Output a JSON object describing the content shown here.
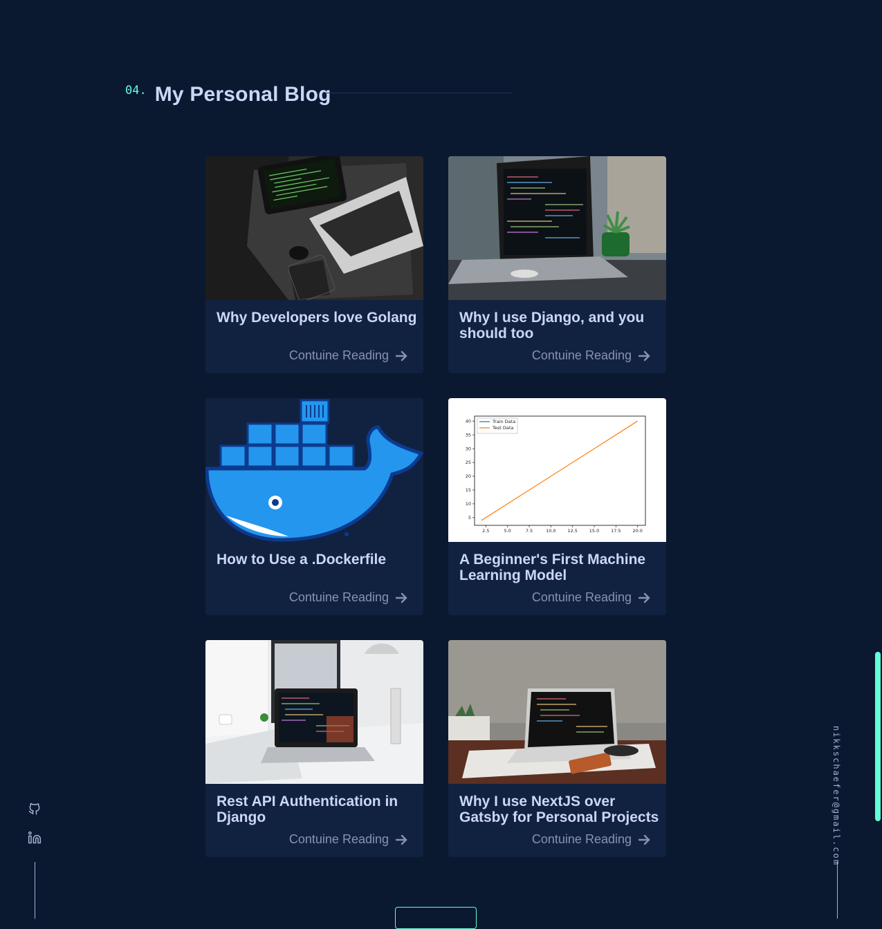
{
  "section": {
    "number": "04.",
    "title": "My Personal Blog"
  },
  "posts": [
    {
      "title": "Why Developers love Golang",
      "link_label": "Contuine Reading"
    },
    {
      "title": "Why I use Django, and you should too",
      "link_label": "Contuine Reading"
    },
    {
      "title": "How to Use a .Dockerfile",
      "link_label": "Contuine Reading"
    },
    {
      "title": "A Beginner's First Machine Learning Model",
      "link_label": "Contuine Reading",
      "chart_data": {
        "type": "line",
        "legend": [
          "Train Data",
          "Test Data"
        ],
        "x_ticks": [
          "2.5",
          "5.0",
          "7.5",
          "10.0",
          "12.5",
          "15.0",
          "17.5",
          "20.0"
        ],
        "y_ticks": [
          "5",
          "10",
          "15",
          "20",
          "25",
          "30",
          "35",
          "40"
        ],
        "series": [
          {
            "name": "Test Data",
            "x": [
              2,
              20
            ],
            "y": [
              4,
              40
            ]
          }
        ],
        "legend_position": "top-left"
      }
    },
    {
      "title": "Rest API Authentication in Django",
      "link_label": "Contuine Reading"
    },
    {
      "title": "Why I use NextJS over Gatsby for Personal Projects",
      "link_label": "Contuine Reading"
    }
  ],
  "email": "nikkschaefer@gmail.com",
  "social": {
    "icons": [
      "github-icon",
      "linkedin-icon"
    ]
  },
  "colors": {
    "accent": "#64ffda",
    "background": "#0a192f",
    "card": "#112240"
  }
}
